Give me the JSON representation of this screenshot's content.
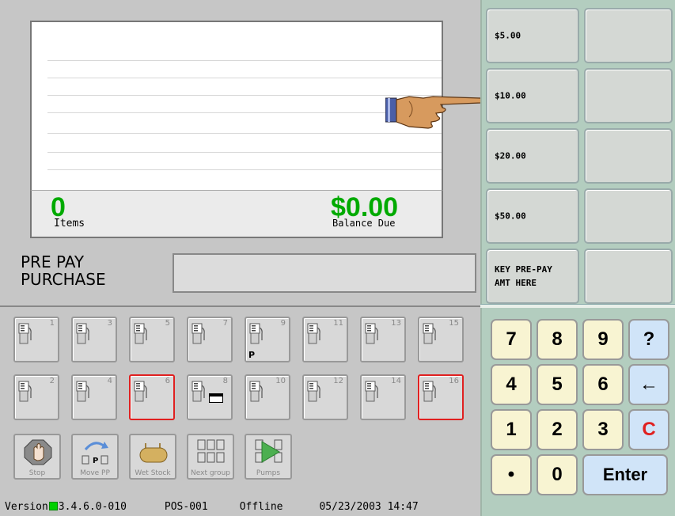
{
  "receipt": {
    "items_count": "0",
    "items_label": "Items",
    "balance": "$0.00",
    "balance_label": "Balance Due"
  },
  "prepay": {
    "label_line1": "PRE PAY",
    "label_line2": "PURCHASE",
    "input_value": ""
  },
  "pumps": [
    {
      "number": "1",
      "tag": "",
      "selected": false
    },
    {
      "number": "3",
      "tag": "",
      "selected": false
    },
    {
      "number": "5",
      "tag": "",
      "selected": false
    },
    {
      "number": "7",
      "tag": "",
      "selected": false
    },
    {
      "number": "9",
      "tag": "P",
      "selected": false
    },
    {
      "number": "11",
      "tag": "",
      "selected": false
    },
    {
      "number": "13",
      "tag": "",
      "selected": false
    },
    {
      "number": "15",
      "tag": "",
      "selected": false
    },
    {
      "number": "2",
      "tag": "",
      "selected": false
    },
    {
      "number": "4",
      "tag": "",
      "selected": false
    },
    {
      "number": "6",
      "tag": "",
      "selected": true
    },
    {
      "number": "8",
      "tag": "",
      "selected": false
    },
    {
      "number": "10",
      "tag": "",
      "selected": false
    },
    {
      "number": "12",
      "tag": "",
      "selected": false
    },
    {
      "number": "14",
      "tag": "",
      "selected": false
    },
    {
      "number": "16",
      "tag": "",
      "selected": true
    }
  ],
  "actions": [
    {
      "label": "Stop",
      "icon": "stop-hand-icon"
    },
    {
      "label": "Move PP",
      "icon": "move-prepay-icon"
    },
    {
      "label": "Wet Stock",
      "icon": "tank-icon"
    },
    {
      "label": "Next group",
      "icon": "pump-group-icon"
    },
    {
      "label": "Pumps",
      "icon": "pumps-play-icon"
    }
  ],
  "status": {
    "version_prefix": "Version",
    "version_number": "3.4.6.0-010",
    "terminal": "POS-001",
    "connection": "Offline",
    "datetime": "05/23/2003 14:47"
  },
  "right_panel": {
    "amount_buttons": [
      {
        "line1": "$5.00",
        "line2": ""
      },
      {
        "line1": "$10.00",
        "line2": ""
      },
      {
        "line1": "$20.00",
        "line2": ""
      },
      {
        "line1": "$50.00",
        "line2": ""
      },
      {
        "line1": "KEY PRE-PAY",
        "line2": "AMT HERE"
      }
    ],
    "blank_buttons": [
      "",
      "",
      "",
      "",
      ""
    ]
  },
  "keypad": {
    "keys": [
      "7",
      "8",
      "9",
      "?",
      "4",
      "5",
      "6",
      "←",
      "1",
      "2",
      "3",
      "C",
      "•",
      "0",
      "Enter"
    ]
  },
  "colors": {
    "accent_green": "#00aa00",
    "selected_border": "#e02020",
    "clear_key": "#e02020",
    "keypad_bg": "#f8f4d2",
    "keypad_blue": "#d0e4f8"
  }
}
